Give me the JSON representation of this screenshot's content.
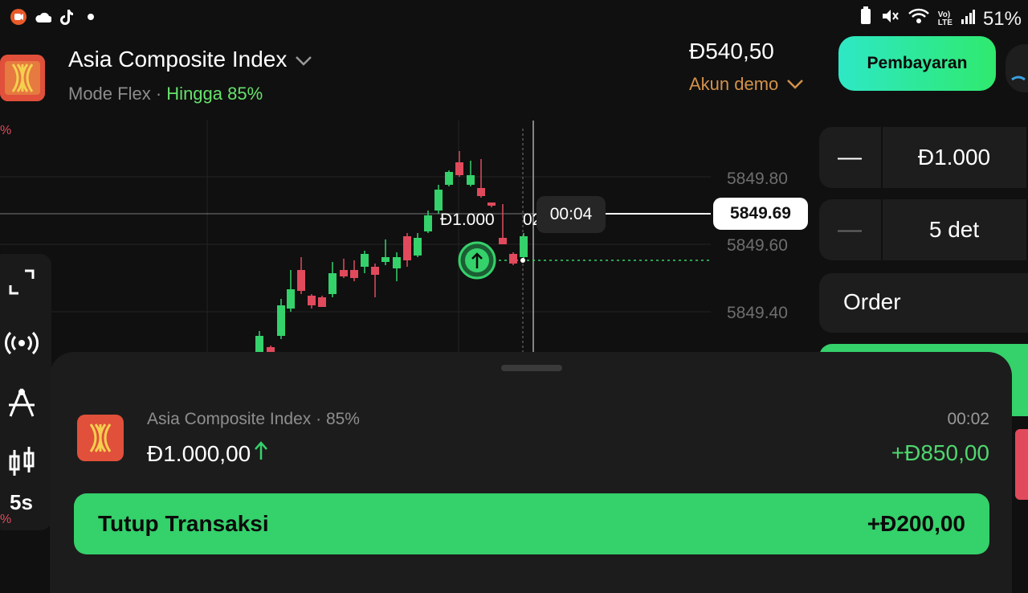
{
  "status": {
    "left_icons": [
      "screen-recorder-icon",
      "cloud-icon",
      "tiktok-icon",
      "dot-icon"
    ],
    "right_icons": [
      "battery-saver-icon",
      "mute-icon",
      "wifi-icon",
      "volte-icon",
      "signal-icon"
    ],
    "battery": "51%"
  },
  "asset": {
    "name": "Asia Composite Index",
    "mode": "Mode Flex",
    "payout": "Hingga 85%"
  },
  "account": {
    "balance": "Đ540,50",
    "type": "Akun demo"
  },
  "pay_button": "Pembayaran",
  "controls": {
    "amount": "Đ1.000",
    "duration": "5 det",
    "order_label": "Order",
    "minus_glyph": "—"
  },
  "chart": {
    "y_ticks": [
      "5849.80",
      "5849.60",
      "5849.40"
    ],
    "current_price": "5849.69",
    "timer": "00:04",
    "trade_label": "Đ1.000",
    "trade_label_cut": "02",
    "pct_top": "%",
    "pct_bottom": "%",
    "colors": {
      "up": "#35d16b",
      "down": "#e04a5c"
    }
  },
  "toolbar": {
    "icons": [
      "expand-icon",
      "signals-icon",
      "drawing-tool-icon",
      "candle-chart-icon"
    ],
    "timeframe": "5s"
  },
  "trade": {
    "name": "Asia Composite Index",
    "percent": "85%",
    "amount": "Đ1.000,00",
    "time_left": "00:02",
    "profit": "+Đ850,00",
    "close_label": "Tutup Transaksi",
    "close_value": "+Đ200,00"
  }
}
